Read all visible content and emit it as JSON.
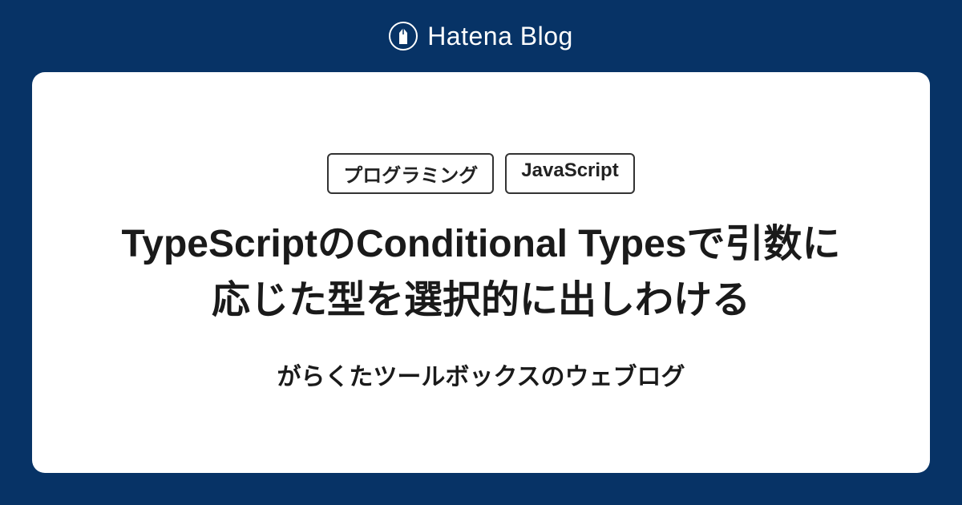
{
  "header": {
    "brand": "Hatena Blog"
  },
  "card": {
    "tags": [
      "プログラミング",
      "JavaScript"
    ],
    "title": "TypeScriptのConditional Typesで引数に応じた型を選択的に出しわける",
    "blog_name": "がらくたツールボックスのウェブログ"
  },
  "colors": {
    "background": "#073366",
    "card_bg": "#ffffff",
    "text": "#1a1a1a"
  }
}
